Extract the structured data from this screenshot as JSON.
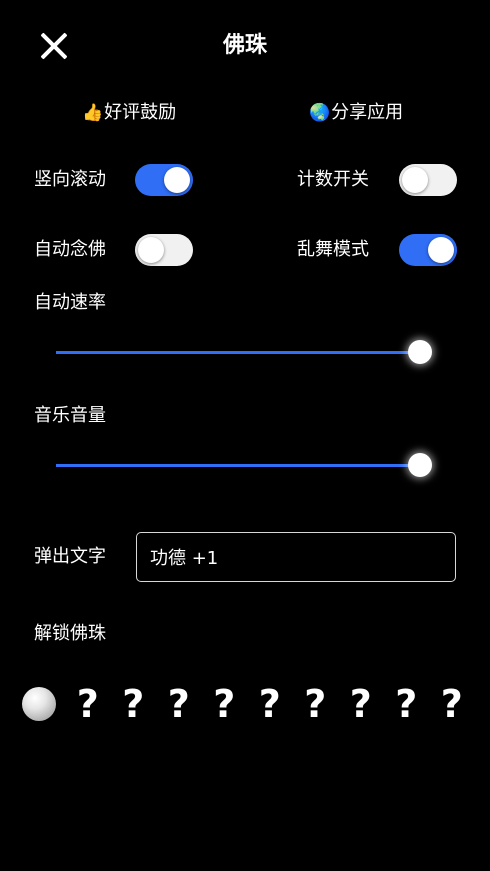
{
  "header": {
    "title": "佛珠",
    "close_icon": "close-icon"
  },
  "actions": {
    "rate_emoji": "👍",
    "rate_label": "好评鼓励",
    "share_emoji": "🌏",
    "share_label": "分享应用"
  },
  "toggles": {
    "vertical_scroll": {
      "label": "竖向滚动",
      "on": true
    },
    "counter": {
      "label": "计数开关",
      "on": false
    },
    "auto_chant": {
      "label": "自动念佛",
      "on": false
    },
    "chaos_dance": {
      "label": "乱舞模式",
      "on": true
    }
  },
  "sliders": {
    "auto_speed": {
      "label": "自动速率",
      "value_percent": 100
    },
    "music_volume": {
      "label": "音乐音量",
      "value_percent": 100
    }
  },
  "popup_text": {
    "label": "弹出文字",
    "value": "功德 +1"
  },
  "unlock": {
    "label": "解锁佛珠",
    "locked_symbol": "?",
    "beads": [
      {
        "icon": "pearl-bead-icon",
        "unlocked": true
      },
      {
        "unlocked": false
      },
      {
        "unlocked": false
      },
      {
        "unlocked": false
      },
      {
        "unlocked": false
      },
      {
        "unlocked": false
      },
      {
        "unlocked": false
      },
      {
        "unlocked": false
      },
      {
        "unlocked": false
      },
      {
        "unlocked": false
      }
    ]
  },
  "colors": {
    "accent": "#2f6ef5",
    "background": "#000000",
    "switch_off": "#f1f1f1",
    "text": "#ffffff"
  }
}
